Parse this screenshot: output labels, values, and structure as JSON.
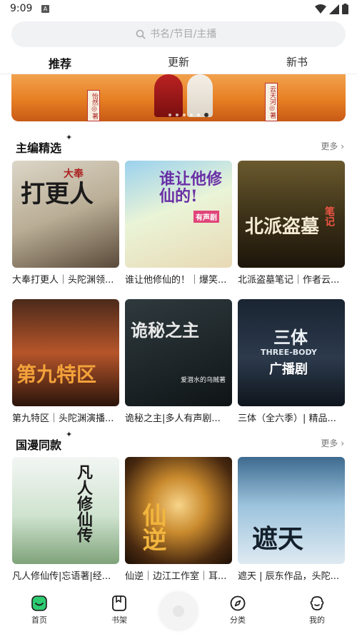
{
  "status": {
    "time": "9:09",
    "notif": "A"
  },
  "search": {
    "placeholder": "书名/节目/主播"
  },
  "tabs": [
    {
      "label": "推荐",
      "active": true
    },
    {
      "label": "更新",
      "active": false
    },
    {
      "label": "新书",
      "active": false
    }
  ],
  "banner": {
    "left_card": "怡然◎著",
    "right_card": "云天河◎著"
  },
  "sections": [
    {
      "title": "主编精选",
      "more": "更多",
      "books": [
        {
          "title": "大奉打更人｜头陀渊领...",
          "cover_text": "打更人",
          "cover_sub": "大奉"
        },
        {
          "title": "谁让他修仙的！｜爆笑...",
          "cover_text": "谁让他修仙的!",
          "cover_sub": "有声剧"
        },
        {
          "title": "北派盗墓笔记｜作者云...",
          "cover_text": "北派盗墓",
          "cover_sub": "笔记"
        },
        {
          "title": "第九特区｜头陀渊演播...",
          "cover_text": "第九特区",
          "cover_sub": ""
        },
        {
          "title": "诡秘之主|多人有声剧...",
          "cover_text": "诡秘之主",
          "cover_sub": "爱潜水的乌贼著"
        },
        {
          "title": "三体（全六季）| 精品...",
          "cover_text": "三体",
          "cover_sub": "THREE-BODY",
          "cover_sub2": "广播剧"
        }
      ]
    },
    {
      "title": "国漫同款",
      "more": "更多",
      "books": [
        {
          "title": "凡人修仙传|忘语著|经...",
          "cover_text": "凡人修仙传",
          "cover_sub": ""
        },
        {
          "title": "仙逆｜边江工作室｜耳...",
          "cover_text": "仙逆",
          "cover_sub": ""
        },
        {
          "title": "遮天 | 辰东作品，头陀...",
          "cover_text": "遮天",
          "cover_sub": ""
        }
      ]
    }
  ],
  "nav": [
    {
      "label": "首页",
      "icon": "home-icon",
      "active": true
    },
    {
      "label": "书架",
      "icon": "bookshelf-icon",
      "active": false
    },
    {
      "label": "分类",
      "icon": "compass-icon",
      "active": false
    },
    {
      "label": "我的",
      "icon": "profile-icon",
      "active": false
    }
  ],
  "colors": {
    "accent": "#2ecc71",
    "search_bg": "#f1f2f4"
  }
}
